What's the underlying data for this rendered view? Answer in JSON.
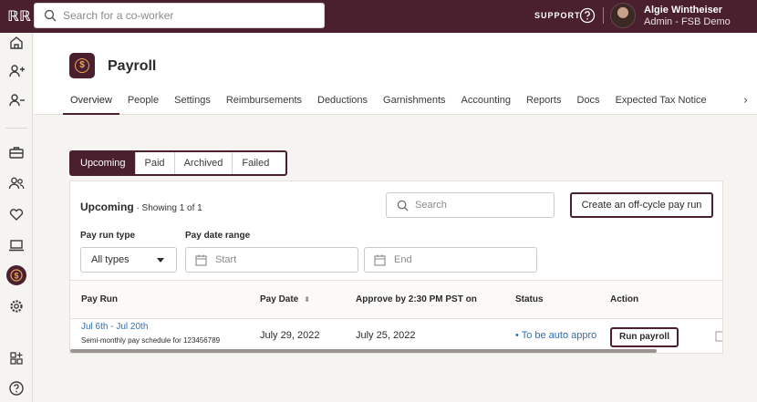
{
  "topbar": {
    "logo_text": "ℝℝ",
    "search_placeholder": "Search for a co-worker",
    "support_label": "SUPPORT",
    "user_name": "Algie Wintheiser",
    "user_role": "Admin - FSB Demo"
  },
  "sidebar": {
    "items": [
      "home-icon",
      "add-person-icon",
      "remove-person-icon",
      "briefcase-icon",
      "people-icon",
      "heart-icon",
      "laptop-icon",
      "dollar-icon",
      "gear-icon",
      "apps-icon",
      "help-icon"
    ],
    "active_item": "dollar-icon"
  },
  "page": {
    "title": "Payroll",
    "icon_glyph": "$",
    "tabs": [
      "Overview",
      "People",
      "Settings",
      "Reimbursements",
      "Deductions",
      "Garnishments",
      "Accounting",
      "Reports",
      "Docs",
      "Expected Tax Notice"
    ],
    "active_tab": "Overview",
    "more_glyph": "›"
  },
  "segment": {
    "items": [
      "Upcoming",
      "Paid",
      "Archived",
      "Failed"
    ],
    "active": "Upcoming"
  },
  "card": {
    "title": "Upcoming",
    "showing": " · Showing 1 of 1",
    "search_placeholder": "Search",
    "offcycle_label": "Create an off-cycle pay run",
    "filters": {
      "type_label": "Pay run type",
      "type_value": "All types",
      "date_label": "Pay date range",
      "start_placeholder": "Start",
      "end_placeholder": "End"
    },
    "columns": [
      "Pay Run",
      "Pay Date",
      "Approve by 2:30 PM PST on",
      "Status",
      "Action"
    ],
    "sort_glyph": "⬍",
    "rows": [
      {
        "pay_run": "Jul 6th - Jul 20th",
        "schedule": "Semi-monthly pay schedule for 123456789",
        "pay_date": "July 29, 2022",
        "approve_by": "July 25, 2022",
        "status": "• To be auto appro",
        "action": "Run payroll"
      }
    ]
  },
  "colors": {
    "brand": "#4a1f2e",
    "link": "#2f6fb5",
    "accent": "#e9a85c"
  }
}
